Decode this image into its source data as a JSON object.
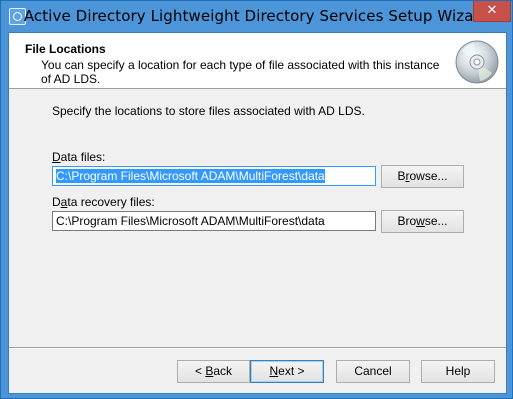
{
  "window": {
    "title": "Active Directory Lightweight Directory Services Setup Wizard",
    "close_label": "✕"
  },
  "header": {
    "heading": "File Locations",
    "description": "You can specify a location for each type of file associated with this instance of AD LDS."
  },
  "main": {
    "instructions": "Specify the locations to store files associated with AD LDS.",
    "data_files": {
      "label_prefix": "D",
      "label_rest": "ata files:",
      "value": "C:\\Program Files\\Microsoft ADAM\\MultiForest\\data",
      "browse_prefix": "B",
      "browse_access": "r",
      "browse_rest": "owse..."
    },
    "data_recovery_files": {
      "label_prefix": "D",
      "label_access": "a",
      "label_rest": "ta recovery files:",
      "value": "C:\\Program Files\\Microsoft ADAM\\MultiForest\\data",
      "browse_prefix": "Bro",
      "browse_access": "w",
      "browse_rest": "se..."
    }
  },
  "footer": {
    "back_arrow": "< ",
    "back_access": "B",
    "back_rest": "ack",
    "next_access": "N",
    "next_rest": "ext >",
    "cancel_label": "Cancel",
    "help_label": "Help"
  }
}
